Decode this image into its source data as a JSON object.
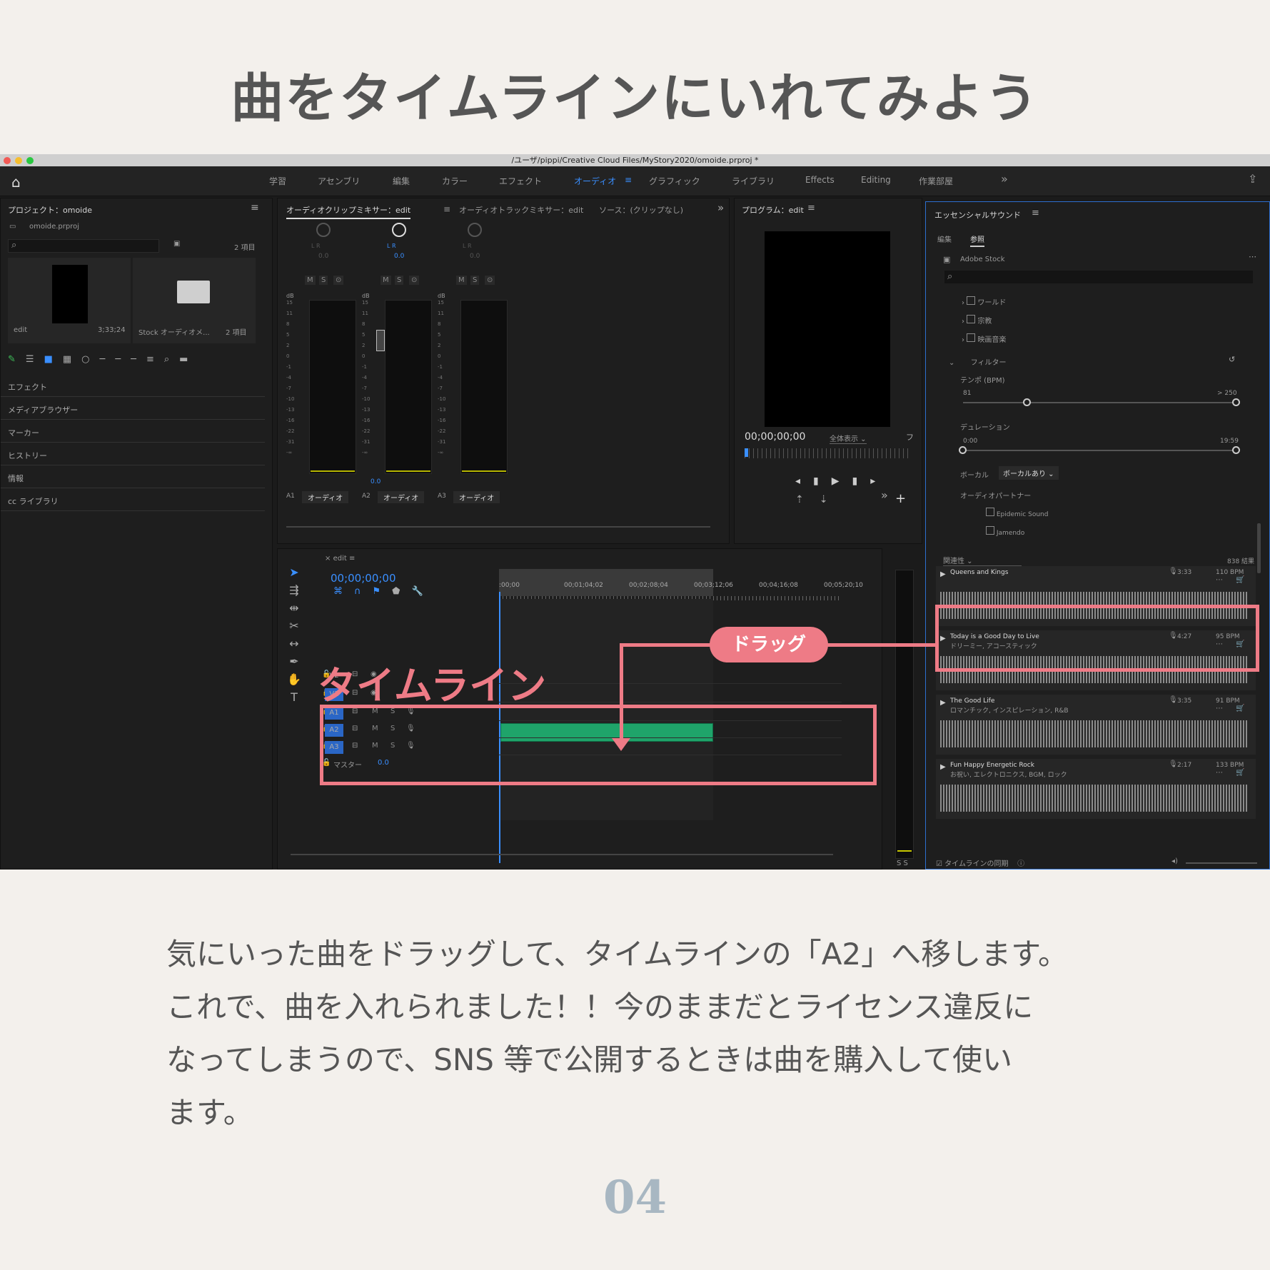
{
  "title": "曲をタイムラインにいれてみよう",
  "window_path": "/ユーザ/pippi/Creative Cloud Files/MyStory2020/omoide.prproj *",
  "workspaces": [
    "学習",
    "アセンブリ",
    "編集",
    "カラー",
    "エフェクト",
    "オーディオ",
    "グラフィック",
    "ライブラリ",
    "Effects",
    "Editing",
    "作業部屋"
  ],
  "project": {
    "header": "プロジェクト：omoide",
    "file": "omoide.prproj",
    "count": "2 項目",
    "bins": [
      {
        "name": "edit",
        "duration": "3;33;24"
      },
      {
        "name": "Stock オーディオメ...",
        "count": "2 項目"
      }
    ]
  },
  "left_tabs": [
    "エフェクト",
    "メディアブラウザー",
    "マーカー",
    "ヒストリー",
    "情報",
    "cc ライブラリ"
  ],
  "mixer": {
    "tabs": [
      "オーディオクリップミキサー：edit",
      "オーディオトラックミキサー：edit",
      "ソース：(クリップなし)"
    ],
    "channels": [
      {
        "track": "A1",
        "name": "オーディオ"
      },
      {
        "track": "A2",
        "name": "オーディオ"
      },
      {
        "track": "A3",
        "name": "オーディオ"
      }
    ],
    "lr": "L  R",
    "val": "0.0",
    "db": "dB",
    "msr": [
      "M",
      "S",
      "⊙"
    ],
    "scale": [
      "15",
      "11",
      "8",
      "5",
      "2",
      "0",
      "-1",
      "-4",
      "-7",
      "-10",
      "-13",
      "-16",
      "-22",
      "-31",
      "-∞"
    ]
  },
  "program": {
    "header": "プログラム：edit",
    "timecode": "00;00;00;00",
    "fit": "全体表示"
  },
  "timeline": {
    "tab": "edit",
    "timecode": "00;00;00;00",
    "ruler": [
      ":00;00",
      "00;01;04;02",
      "00;02;08;04",
      "00;03;12;06",
      "00;04;16;08",
      "00;05;20;10"
    ],
    "tracks": [
      "V2",
      "V1",
      "A1",
      "A2",
      "A3"
    ],
    "master": "マスター",
    "master_val": "0.0",
    "ms": [
      "M",
      "S"
    ]
  },
  "essential": {
    "header": "エッセンシャルサウンド",
    "tabs": [
      "編集",
      "参照"
    ],
    "source": "Adobe Stock",
    "categories": [
      "ワールド",
      "宗教",
      "映画音楽"
    ],
    "filter": "フィルター",
    "tempo": {
      "label": "テンポ (BPM)",
      "min": "81",
      "max": "> 250"
    },
    "duration": {
      "label": "デュレーション",
      "min": "0:00",
      "max": "19:59"
    },
    "vocal": {
      "label": "ボーカル",
      "value": "ボーカルあり"
    },
    "partner": "オーディオパートナー",
    "partners": [
      "Epidemic Sound",
      "Jamendo"
    ],
    "sort": "関連性",
    "results": "838 結果",
    "songs": [
      {
        "title": "Queens and Kings",
        "time": "3:33",
        "bpm": "110 BPM",
        "tags": ""
      },
      {
        "title": "Today is a Good Day to Live",
        "time": "4:27",
        "bpm": "95 BPM",
        "tags": "ドリーミー, アコースティック"
      },
      {
        "title": "The Good Life",
        "time": "3:35",
        "bpm": "91 BPM",
        "tags": "ロマンチック, インスピレーション, R&B"
      },
      {
        "title": "Fun Happy Energetic Rock",
        "time": "2:17",
        "bpm": "133 BPM",
        "tags": "お祝い, エレクトロニクス, BGM, ロック"
      }
    ],
    "sync": "タイムラインの同期"
  },
  "annotations": {
    "drag": "ドラッグ",
    "timeline": "タイムライン"
  },
  "body": "気にいった曲をドラッグして、タイムラインの「A2」へ移します。\nこれで、曲を入れられました！！今のままだとライセンス違反に\nなってしまうので、SNS 等で公開するときは曲を購入して使い\nます。",
  "page_number": "04",
  "colors": {
    "accent": "#ee7b86",
    "clip": "#1fa46a",
    "select_blue": "#3a8fff"
  }
}
